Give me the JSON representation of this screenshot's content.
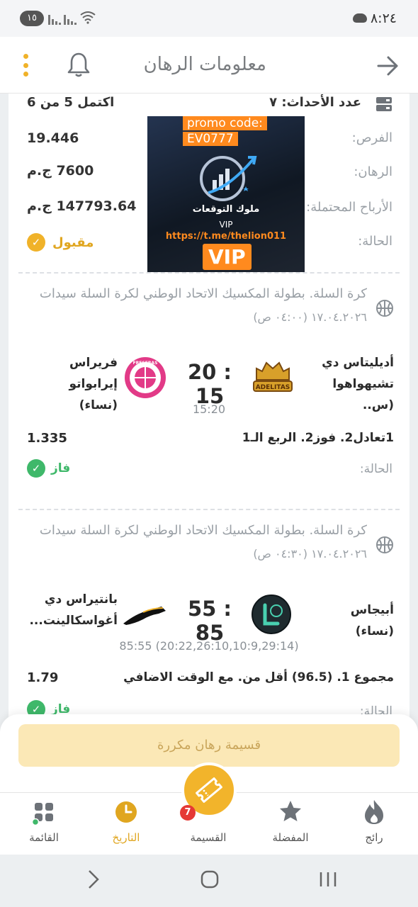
{
  "status_bar": {
    "time": "٨:٢٤",
    "notification_count": "١٥"
  },
  "header": {
    "title": "معلومات الرهان"
  },
  "summary": {
    "events_label": "عدد الأحداث: ٧",
    "completed_text": "اكتمل 5 من 6",
    "odds_label": "الفرص:",
    "odds_value": "19.446",
    "stake_label": "الرهان:",
    "stake_value": "7600 ج.م",
    "potential_label": "الأرباح المحتملة:",
    "potential_value": "147793.64 ج.م",
    "status_label": "الحالة:",
    "status_value": "مقبول",
    "status_color": "#e0a620"
  },
  "promo": {
    "code_line1": "promo code:",
    "code_line2": "EV0777",
    "brand_name": "ملوك التوقعات",
    "vip_small": "VIP",
    "url": "https://t.me/thelion011",
    "vip_big": "VIP"
  },
  "events": [
    {
      "league": "كرة السلة. بطولة المكسيك الاتحاد الوطني لكرة السلة سيدات",
      "date": "١٧.٠٤.٢٠٢٦ (٠٤:٠٠ ص)",
      "home_team": "أديليتاس دي تشيهواهوا (س..",
      "away_team": "فريراس إيرابواتو (نساء)",
      "score": "20 : 15",
      "sub_score": "15:20",
      "market": "1تعادل2. فوز2. الربع الـ1",
      "odds": "1.335",
      "status_label": "الحالة:",
      "status_value": "فاز",
      "home_logo_text": "ADELITAS",
      "away_logo_text": "FRESERAS"
    },
    {
      "league": "كرة السلة. بطولة المكسيك الاتحاد الوطني لكرة السلة سيدات",
      "date": "١٧.٠٤.٢٠٢٦ (٠٤:٣٠ ص)",
      "home_team": "أبيجاس (نساء)",
      "away_team": "بانتيراس دي أغواسكالينت...",
      "score": "55 : 85",
      "sub_score": "85:55 (20:22,26:10,10:9,29:14)",
      "market": "مجموع 1. (96.5) أقل من. مع الوقت الاضافي",
      "odds": "1.79",
      "status_label": "الحالة:",
      "status_value": "فاز"
    }
  ],
  "won_color": "#3fb86a",
  "repeat_button": "قسيمة رهان مكررة",
  "nav": {
    "popular": "رائج",
    "favorites": "المفضلة",
    "coupon": "القسيمة",
    "coupon_badge": "7",
    "history": "التاريخ",
    "menu": "القائمة"
  },
  "accent_color": "#f2b42b"
}
